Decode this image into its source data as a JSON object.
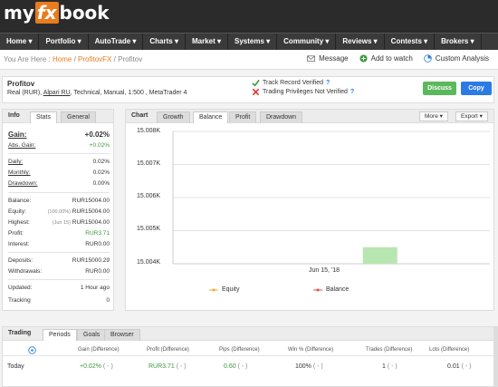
{
  "logo": {
    "pre": "my",
    "fx": "fx",
    "post": "book"
  },
  "nav": [
    "Home ▾",
    "Portfolio ▾",
    "AutoTrade ▾",
    "Charts ▾",
    "Market ▾",
    "Systems ▾",
    "Community ▾",
    "Reviews ▾",
    "Contests ▾",
    "Brokers ▾"
  ],
  "breadcrumb": {
    "prefix": "You Are Here :",
    "home": "Home",
    "sep": "/",
    "parent": "ProfitovFX",
    "current": "Profitov"
  },
  "toplinks": {
    "message": "Message",
    "watch": "Add to watch",
    "analysis": "Custom Analysis"
  },
  "account": {
    "name": "Profitov",
    "desc_pre": "Real (RUR), ",
    "broker": "Alpari RU",
    "desc_post": ", Technical, Manual, 1:500 , MetaTrader 4",
    "verif1": "Track Record Verified",
    "verif2": "Trading Privileges Not Verified",
    "q": "?",
    "discuss": "Discuss",
    "copy": "Copy"
  },
  "info": {
    "title": "Info",
    "tabs": [
      "Stats",
      "General"
    ],
    "gain_label": "Gain:",
    "gain_value": "+0.02%",
    "abs_gain_label": "Abs. Gain:",
    "abs_gain_value": "+0.02%",
    "daily_label": "Daily:",
    "daily_value": "0.02%",
    "monthly_label": "Monthly:",
    "monthly_value": "0.02%",
    "drawdown_label": "Drawdown:",
    "drawdown_value": "0.00%",
    "balance_label": "Balance:",
    "balance_value": "RUR15004.00",
    "equity_label": "Equity:",
    "equity_pct": "(100.00%)",
    "equity_value": "RUR15004.00",
    "highest_label": "Highest:",
    "highest_date": "(Jun 15)",
    "highest_value": "RUR15004.00",
    "profit_label": "Profit:",
    "profit_value": "RUR3.71",
    "interest_label": "Interest:",
    "interest_value": "RUR0.00",
    "deposits_label": "Deposits:",
    "deposits_value": "RUR15000.29",
    "withdrawals_label": "Withdrawals:",
    "withdrawals_value": "RUR0.00",
    "updated_label": "Updated:",
    "updated_value": "1 Hour ago",
    "tracking_label": "Tracking",
    "tracking_value": "0"
  },
  "chart": {
    "title": "Chart",
    "tabs": [
      "Growth",
      "Balance",
      "Profit",
      "Drawdown"
    ],
    "more": "More ▾",
    "export": "Export ▾",
    "legend_equity": "Equity",
    "legend_balance": "Balance",
    "colors": {
      "equity": "#f0a830",
      "balance": "#e05050",
      "bar": "#b8e6b0"
    }
  },
  "chart_data": {
    "type": "bar",
    "categories": [
      "Jun 15, '18"
    ],
    "series": [
      {
        "name": "Balance",
        "values": [
          15004.0
        ]
      }
    ],
    "yticks": [
      "15.008K",
      "15.007K",
      "15.006K",
      "15.005K",
      "15.004K"
    ],
    "ylim": [
      15004,
      15008
    ],
    "legend": [
      "Equity",
      "Balance"
    ]
  },
  "trading": {
    "title": "Trading",
    "tabs": [
      "Periods",
      "Goals",
      "Browser"
    ],
    "columns": [
      "Gain (Difference)",
      "Profit (Difference)",
      "Pips (Difference)",
      "Win % (Difference)",
      "Trades (Difference)",
      "Lots (Difference)"
    ],
    "row": {
      "label": "Today",
      "gain": "+0.02%",
      "gain_diff": "( - )",
      "profit": "RUR3.71",
      "profit_diff": "( - )",
      "pips": "0.60",
      "pips_diff": "( - )",
      "win": "100%",
      "win_diff": "( - )",
      "trades": "1",
      "trades_diff": "( - )",
      "lots": "0.01",
      "lots_diff": "( - )"
    }
  }
}
